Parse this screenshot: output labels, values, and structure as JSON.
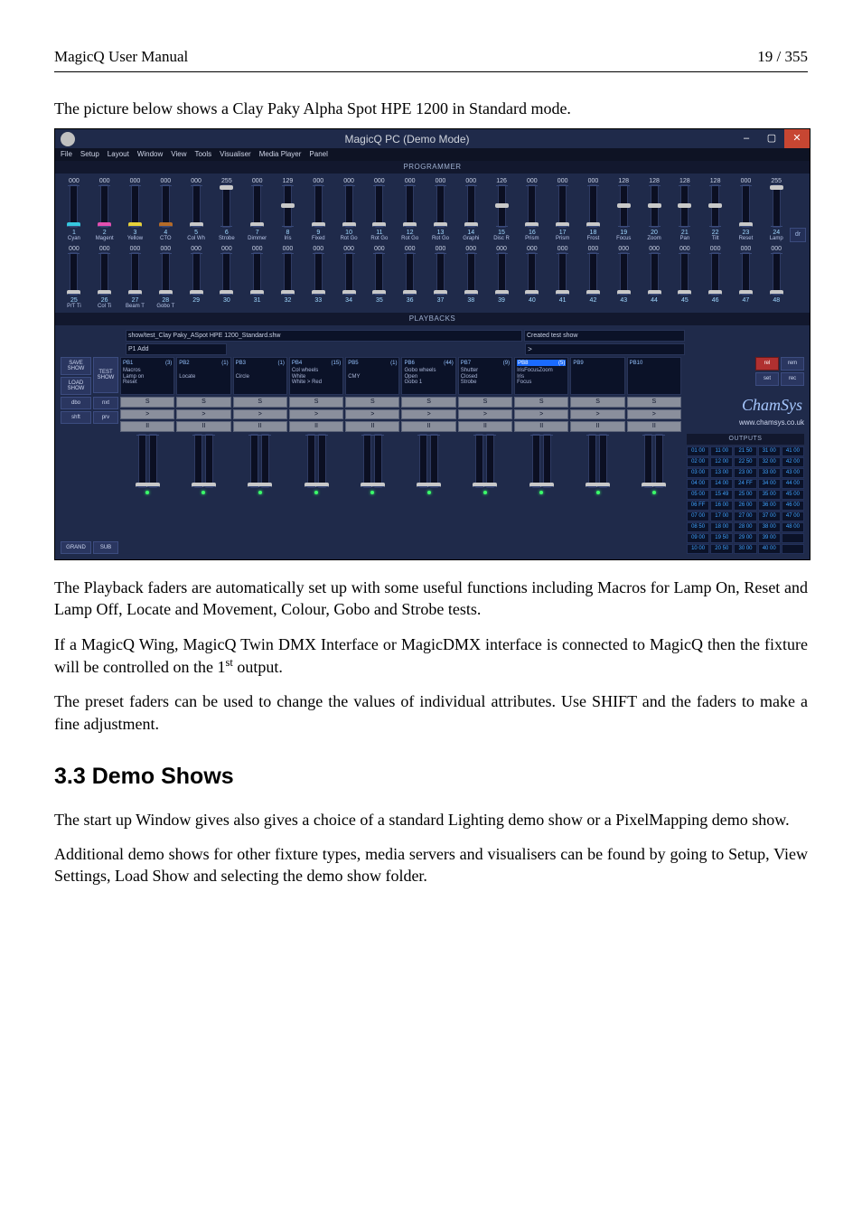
{
  "doc": {
    "title_left": "MagicQ User Manual",
    "page_right": "19 / 355",
    "intro": "The picture below shows a Clay Paky Alpha Spot HPE 1200 in Standard mode.",
    "p1": "The Playback faders are automatically set up with some useful functions including Macros for Lamp On, Reset and Lamp Off, Locate and Movement, Colour, Gobo and Strobe tests.",
    "p2a": "If a MagicQ Wing, MagicQ Twin DMX Interface or MagicDMX interface is connected to MagicQ then the fixture will be controlled on the 1",
    "p2b": " output.",
    "p3": "The preset faders can be used to change the values of individual attributes. Use SHIFT and the faders to make a fine adjustment.",
    "section": "3.3   Demo Shows",
    "p4": "The start up Window gives also gives a choice of a standard Lighting demo show or a PixelMapping demo show.",
    "p5": "Additional demo shows for other fixture types, media servers and visualisers can be found by going to Setup, View Settings, Load Show and selecting the demo show folder."
  },
  "shot": {
    "window_title": "MagicQ PC (Demo Mode)",
    "menu": [
      "File",
      "Setup",
      "Layout",
      "Window",
      "View",
      "Tools",
      "Visualiser",
      "Media Player",
      "Panel"
    ],
    "prog_label": "PROGRAMMER",
    "dr": "dr",
    "row1": [
      {
        "v": "000",
        "n": "1",
        "nm": "Cyan",
        "c": "#36c7e0"
      },
      {
        "v": "000",
        "n": "2",
        "nm": "Magent",
        "c": "#e24fb0"
      },
      {
        "v": "000",
        "n": "3",
        "nm": "Yellow",
        "c": "#e6d13a"
      },
      {
        "v": "000",
        "n": "4",
        "nm": "CTO",
        "c": "#b46b28"
      },
      {
        "v": "000",
        "n": "5",
        "nm": "Col Wh",
        "c": "#c8c8c8"
      },
      {
        "v": "255",
        "n": "6",
        "nm": "Strobe",
        "c": "#c8c8c8",
        "top": true
      },
      {
        "v": "000",
        "n": "7",
        "nm": "Dimmer",
        "c": "#c8c8c8"
      },
      {
        "v": "129",
        "n": "8",
        "nm": "Iris",
        "c": "#c8c8c8",
        "mid": true
      },
      {
        "v": "000",
        "n": "9",
        "nm": "Fixed",
        "c": "#c8c8c8"
      },
      {
        "v": "000",
        "n": "10",
        "nm": "Rot Go",
        "c": "#c8c8c8"
      },
      {
        "v": "000",
        "n": "11",
        "nm": "Rot Go",
        "c": "#c8c8c8"
      },
      {
        "v": "000",
        "n": "12",
        "nm": "Rot Go",
        "c": "#c8c8c8"
      },
      {
        "v": "000",
        "n": "13",
        "nm": "Rot Go",
        "c": "#c8c8c8"
      },
      {
        "v": "000",
        "n": "14",
        "nm": "Graphi",
        "c": "#c8c8c8"
      },
      {
        "v": "126",
        "n": "15",
        "nm": "Disc R",
        "c": "#c8c8c8",
        "mid": true
      },
      {
        "v": "000",
        "n": "16",
        "nm": "Prism",
        "c": "#c8c8c8"
      },
      {
        "v": "000",
        "n": "17",
        "nm": "Prism",
        "c": "#c8c8c8"
      },
      {
        "v": "000",
        "n": "18",
        "nm": "Frost",
        "c": "#c8c8c8"
      },
      {
        "v": "128",
        "n": "19",
        "nm": "Focus",
        "c": "#c8c8c8",
        "mid": true
      },
      {
        "v": "128",
        "n": "20",
        "nm": "Zoom",
        "c": "#c8c8c8",
        "mid": true
      },
      {
        "v": "128",
        "n": "21",
        "nm": "Pan",
        "c": "#c8c8c8",
        "mid": true
      },
      {
        "v": "128",
        "n": "22",
        "nm": "Tilt",
        "c": "#c8c8c8",
        "mid": true
      },
      {
        "v": "000",
        "n": "23",
        "nm": "Reset",
        "c": "#c8c8c8"
      },
      {
        "v": "255",
        "n": "24",
        "nm": "Lamp",
        "c": "#c8c8c8",
        "top": true
      }
    ],
    "row2": [
      {
        "v": "000",
        "n": "25",
        "nm": "P/T Ti"
      },
      {
        "v": "000",
        "n": "26",
        "nm": "Col Ti"
      },
      {
        "v": "000",
        "n": "27",
        "nm": "Beam T"
      },
      {
        "v": "000",
        "n": "28",
        "nm": "Gobo T"
      },
      {
        "v": "000",
        "n": "29",
        "nm": ""
      },
      {
        "v": "000",
        "n": "30",
        "nm": ""
      },
      {
        "v": "000",
        "n": "31",
        "nm": ""
      },
      {
        "v": "000",
        "n": "32",
        "nm": ""
      },
      {
        "v": "000",
        "n": "33",
        "nm": ""
      },
      {
        "v": "000",
        "n": "34",
        "nm": ""
      },
      {
        "v": "000",
        "n": "35",
        "nm": ""
      },
      {
        "v": "000",
        "n": "36",
        "nm": ""
      },
      {
        "v": "000",
        "n": "37",
        "nm": ""
      },
      {
        "v": "000",
        "n": "38",
        "nm": ""
      },
      {
        "v": "000",
        "n": "39",
        "nm": ""
      },
      {
        "v": "000",
        "n": "40",
        "nm": ""
      },
      {
        "v": "000",
        "n": "41",
        "nm": ""
      },
      {
        "v": "000",
        "n": "42",
        "nm": ""
      },
      {
        "v": "000",
        "n": "43",
        "nm": ""
      },
      {
        "v": "000",
        "n": "44",
        "nm": ""
      },
      {
        "v": "000",
        "n": "45",
        "nm": ""
      },
      {
        "v": "000",
        "n": "46",
        "nm": ""
      },
      {
        "v": "000",
        "n": "47",
        "nm": ""
      },
      {
        "v": "000",
        "n": "48",
        "nm": ""
      }
    ],
    "pb_label": "PLAYBACKS",
    "pb_file": "show/test_Clay Paky_ASpot HPE 1200_Standard.shw",
    "pb_p1": "P1  Add",
    "pb_status": "Created test show",
    "side": {
      "save": "SAVE\nSHOW",
      "load": "LOAD\nSHOW",
      "test": "TEST\nSHOW",
      "grand": "GRAND",
      "sub": "SUB"
    },
    "slots": [
      {
        "id": "PB1",
        "cnt": "(3)",
        "t": "Macros\nLamp on\nReset"
      },
      {
        "id": "PB2",
        "cnt": "(1)",
        "t": "\nLocate"
      },
      {
        "id": "PB3",
        "cnt": "(1)",
        "t": "\nCircle"
      },
      {
        "id": "PB4",
        "cnt": "(15)",
        "t": "Col wheels\nWhite\nWhite > Red"
      },
      {
        "id": "PB5",
        "cnt": "(1)",
        "t": "\nCMY"
      },
      {
        "id": "PB6",
        "cnt": "(44)",
        "t": "Gobo wheels\nOpen\nGobo 1"
      },
      {
        "id": "PB7",
        "cnt": "(9)",
        "t": "Shutter\nClosed\nStrobe"
      },
      {
        "id": "PB8",
        "cnt": "(5)",
        "t": "IrisFocusZoom\nIris\nFocus",
        "hl": true
      },
      {
        "id": "PB9",
        "cnt": "",
        "t": ""
      },
      {
        "id": "PB10",
        "cnt": "",
        "t": ""
      }
    ],
    "pbtns": {
      "s": "S",
      "go": ">",
      "pause": "II"
    },
    "trans": {
      "dbo": "dbo",
      "nxt": "nxt",
      "shft": "shft",
      "prv": "prv"
    },
    "rel": {
      "rel": "rel",
      "rem": "rem",
      "set": "set",
      "rec": "rec"
    },
    "brand": "ChamSys",
    "url": "www.chamsys.co.uk",
    "outputs_label": "OUTPUTS",
    "outputs": [
      [
        "01 00",
        "11 00",
        "21 50",
        "31 00",
        "41 00"
      ],
      [
        "02 00",
        "12 00",
        "22 50",
        "32 00",
        "42 00"
      ],
      [
        "03 00",
        "13 00",
        "23 00",
        "33 00",
        "43 00"
      ],
      [
        "04 00",
        "14 00",
        "24 FF",
        "34 00",
        "44 00"
      ],
      [
        "05 00",
        "15 49",
        "25 00",
        "35 00",
        "45 00"
      ],
      [
        "06 FF",
        "16 00",
        "26 00",
        "36 00",
        "46 00"
      ],
      [
        "07 00",
        "17 00",
        "27 00",
        "37 00",
        "47 00"
      ],
      [
        "08 50",
        "18 00",
        "28 00",
        "38 00",
        "48 00"
      ],
      [
        "09 00",
        "19 50",
        "29 00",
        "39 00",
        ""
      ],
      [
        "10 00",
        "20 50",
        "30 00",
        "40 00",
        ""
      ]
    ]
  }
}
